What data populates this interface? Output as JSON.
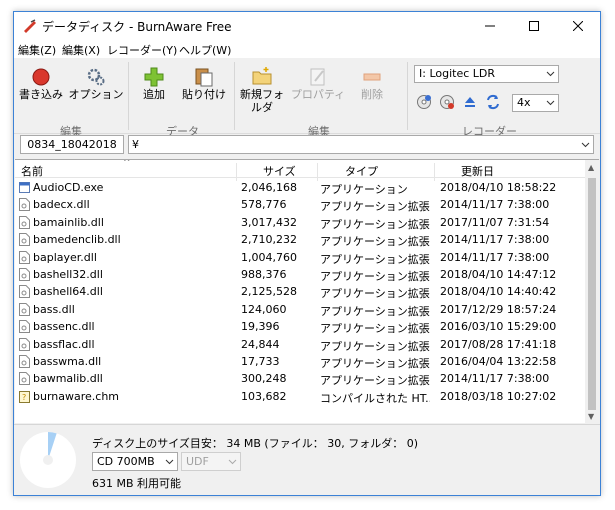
{
  "window": {
    "title": "データディスク - BurnAware Free"
  },
  "menu": [
    "編集(Z)",
    "編集(X)",
    "レコーダー(Y)",
    "ヘルプ(W)"
  ],
  "toolbar": {
    "burn": "書き込み",
    "options": "オプション",
    "add": "追加",
    "paste": "貼り付け",
    "new_folder": "新規フォルダ",
    "properties": "プロパティ",
    "delete": "削除",
    "group_edit1": "編集",
    "group_data": "データ",
    "group_edit2": "編集",
    "group_recorder": "レコーダー"
  },
  "recorder": {
    "drive": "I: Logitec LDR",
    "speed": "4x"
  },
  "compilation_name": "0834_18042018",
  "path": "¥",
  "columns": {
    "name": "名前",
    "size": "サイズ",
    "type": "タイプ",
    "updated": "更新日"
  },
  "files": [
    {
      "name": "AudioCD.exe",
      "size": "2,046,168",
      "type": "アプリケーション",
      "date": "2018/04/10 18:58:22",
      "icon": "exe-icon"
    },
    {
      "name": "badecx.dll",
      "size": "578,776",
      "type": "アプリケーション拡張",
      "date": "2014/11/17 7:38:00",
      "icon": "dll-icon"
    },
    {
      "name": "bamainlib.dll",
      "size": "3,017,432",
      "type": "アプリケーション拡張",
      "date": "2017/11/07 7:31:54",
      "icon": "dll-icon"
    },
    {
      "name": "bamedenclib.dll",
      "size": "2,710,232",
      "type": "アプリケーション拡張",
      "date": "2014/11/17 7:38:00",
      "icon": "dll-icon"
    },
    {
      "name": "baplayer.dll",
      "size": "1,004,760",
      "type": "アプリケーション拡張",
      "date": "2014/11/17 7:38:00",
      "icon": "dll-icon"
    },
    {
      "name": "bashell32.dll",
      "size": "988,376",
      "type": "アプリケーション拡張",
      "date": "2018/04/10 14:47:12",
      "icon": "dll-icon"
    },
    {
      "name": "bashell64.dll",
      "size": "2,125,528",
      "type": "アプリケーション拡張",
      "date": "2018/04/10 14:40:42",
      "icon": "dll-icon"
    },
    {
      "name": "bass.dll",
      "size": "124,060",
      "type": "アプリケーション拡張",
      "date": "2017/12/29 18:57:24",
      "icon": "dll-icon"
    },
    {
      "name": "bassenc.dll",
      "size": "19,396",
      "type": "アプリケーション拡張",
      "date": "2016/03/10 15:29:00",
      "icon": "dll-icon"
    },
    {
      "name": "bassflac.dll",
      "size": "24,844",
      "type": "アプリケーション拡張",
      "date": "2017/08/28 17:41:18",
      "icon": "dll-icon"
    },
    {
      "name": "basswma.dll",
      "size": "17,733",
      "type": "アプリケーション拡張",
      "date": "2016/04/04 13:22:58",
      "icon": "dll-icon"
    },
    {
      "name": "bawmalib.dll",
      "size": "300,248",
      "type": "アプリケーション拡張",
      "date": "2014/11/17 7:38:00",
      "icon": "dll-icon"
    },
    {
      "name": "burnaware.chm",
      "size": "103,682",
      "type": "コンパイルされた HT...",
      "date": "2018/03/18 10:27:02",
      "icon": "chm-icon"
    }
  ],
  "status": {
    "estimate": "ディスク上のサイズ目安： 34 MB (ファイル： 30, フォルダ： 0)",
    "disc_type": "CD 700MB",
    "filesystem": "UDF",
    "free": "631 MB 利用可能",
    "used_fraction": 0.05
  }
}
